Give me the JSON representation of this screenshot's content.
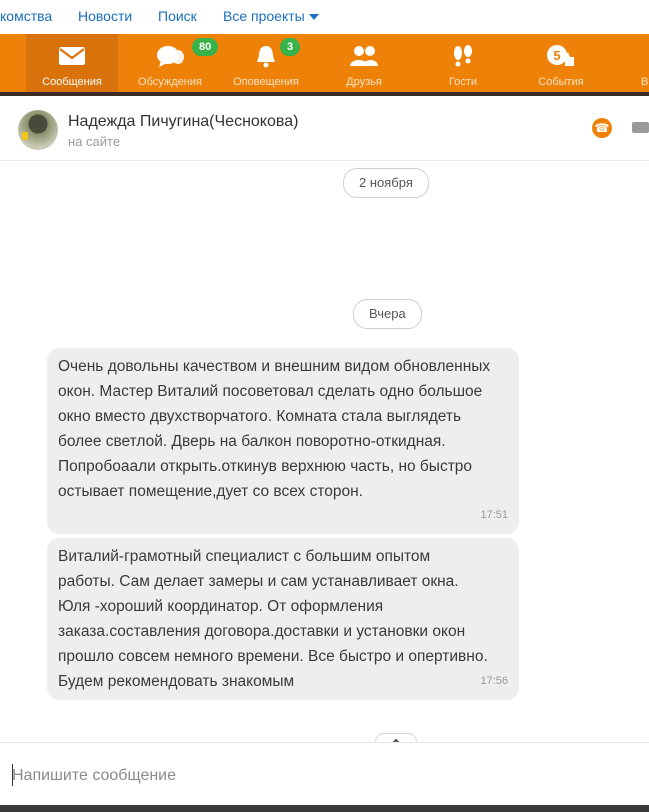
{
  "top_links": [
    {
      "label": "комства"
    },
    {
      "label": "Новости"
    },
    {
      "label": "Поиск"
    },
    {
      "label": "Все проекты"
    }
  ],
  "nav": {
    "items": [
      {
        "label": "Сообщения",
        "icon": "envelope-icon"
      },
      {
        "label": "Обсуждения",
        "icon": "chat-bubbles-icon",
        "badge": "80"
      },
      {
        "label": "Оповещения",
        "icon": "bell-icon",
        "badge": "3"
      },
      {
        "label": "Друзья",
        "icon": "friends-icon"
      },
      {
        "label": "Гости",
        "icon": "footprints-icon"
      },
      {
        "label": "События",
        "icon": "events-icon",
        "badge": "5"
      },
      {
        "label": "В"
      }
    ]
  },
  "chat": {
    "contact_name": "Надежда Пичугина(Чеснокова)",
    "contact_status": "на сайте",
    "date_separators": [
      "2 ноября",
      "Вчера"
    ],
    "messages": [
      {
        "text": "Очень довольны качеством и внешним видом обновленных окон. Мастер Виталий посоветовал сделать одно большое окно вместо двухстворчатого.  Комната стала выглядеть более светлой. Дверь на балкон поворотно-откидная. Попробоаали открыть.откинув верхнюю часть, но быстро остывает помещение,дует со всех сторон.",
        "time": "17:51"
      },
      {
        "text": "Виталий-грамотный специалист с большим опытом работы. Сам делает замеры и сам устанавливает окна. Юля -хороший координатор. От оформления заказа.составления договора.доставки и установки окон прошло совсем немного времени. Все быстро и опертивно. Будем рекомендовать знакомым",
        "time": "17:56"
      }
    ]
  },
  "composer": {
    "placeholder": "Напишите сообщение"
  },
  "colors": {
    "accent": "#ee8208",
    "badge": "#38b349",
    "link": "#1b6fbf"
  }
}
